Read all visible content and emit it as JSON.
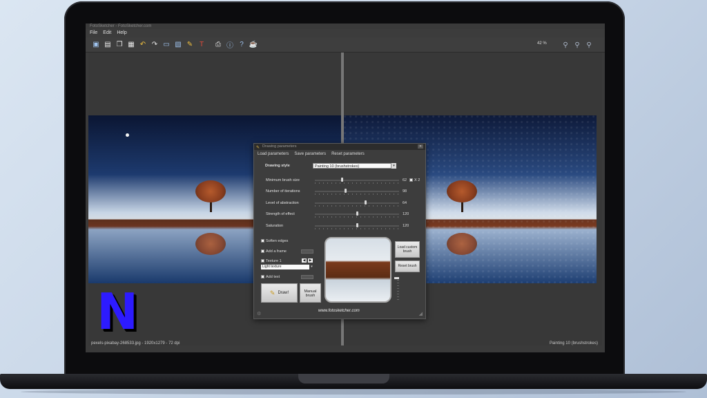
{
  "app": {
    "title": "FotoSketcher - FotoSketcher.com",
    "menu": [
      "File",
      "Edit",
      "Help"
    ],
    "zoom": "42 %",
    "status_left": "pexels-pixabay-268533.jpg - 1920x1279 - 72 dpi",
    "status_right": "Painting 10 (brushstrokes)",
    "toolbar_icons": [
      "open-icon",
      "save-icon",
      "copy-icon",
      "paste-icon",
      "undo-icon",
      "redo-icon",
      "image-icon",
      "landscape-icon",
      "brush-icon",
      "text-icon",
      "print-icon",
      "info-icon",
      "help-icon",
      "coffee-icon"
    ],
    "zoom_icons": [
      "zoom-out-icon",
      "zoom-fit-icon",
      "zoom-in-icon"
    ]
  },
  "dialog": {
    "title": "Drawing parameters",
    "menu": [
      "Load parameters",
      "Save parameters",
      "Reset parameters"
    ],
    "style_label": "Drawing style",
    "style_value": "Painting 10 (brushstrokes)",
    "sliders": [
      {
        "label": "Minimum brush size",
        "value": "62",
        "pos": 0.32
      },
      {
        "label": "Number of iterations",
        "value": "98",
        "pos": 0.36
      },
      {
        "label": "Level of abstraction",
        "value": "64",
        "pos": 0.6
      },
      {
        "label": "Strength of effect",
        "value": "120",
        "pos": 0.5
      },
      {
        "label": "Saturation",
        "value": "120",
        "pos": 0.5
      }
    ],
    "x2_label": "X 2",
    "checkboxes": [
      {
        "label": "Soften edges"
      },
      {
        "label": "Add a frame"
      },
      {
        "label": "Texture 1"
      },
      {
        "label": "Add text"
      }
    ],
    "texture_value": "Light texture",
    "draw_label": "Draw!",
    "manual_label": "Manual brush",
    "custom_brush_label": "Load custom brush",
    "reset_brush_label": "Reset brush",
    "website": "www.fotosketcher.com"
  },
  "logo": {
    "letter": "N",
    "color": "#2d1bff"
  }
}
